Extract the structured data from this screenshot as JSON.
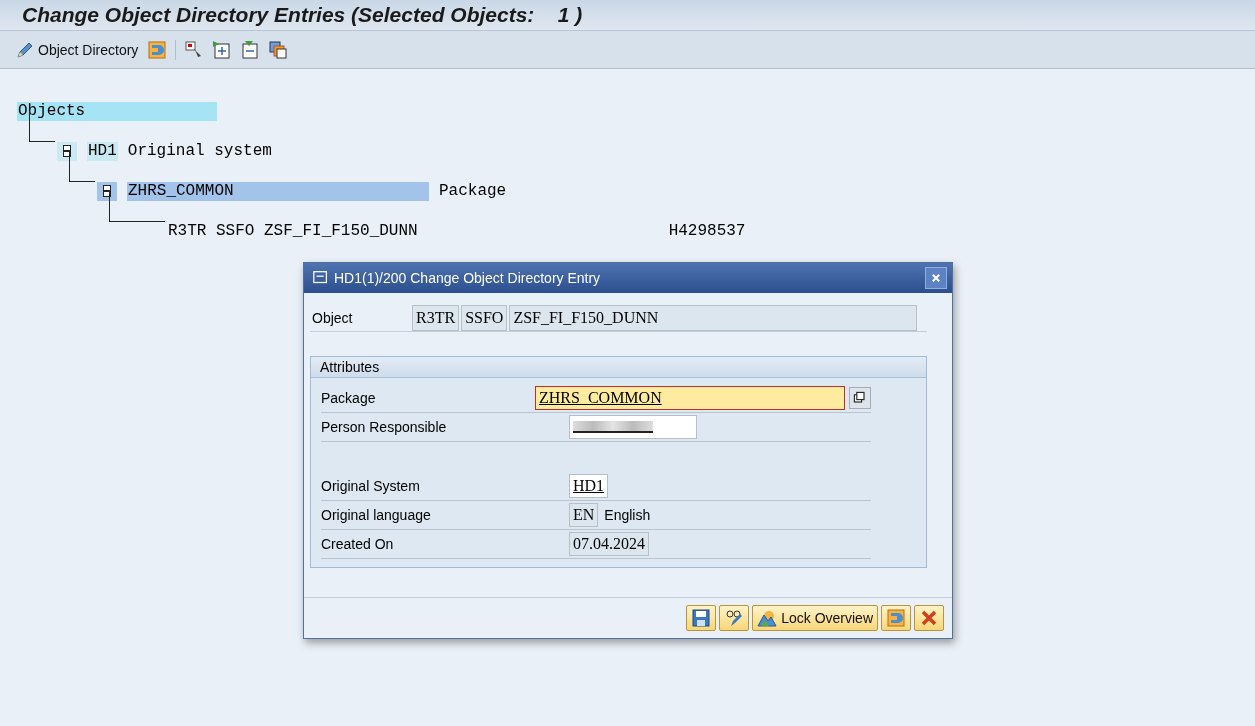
{
  "window": {
    "title": "Change Object Directory Entries (Selected Objects:    1 )"
  },
  "toolbar": {
    "items": [
      {
        "kind": "text",
        "label": "Object Directory"
      },
      {
        "kind": "icon"
      },
      {
        "kind": "sep"
      },
      {
        "kind": "icon"
      },
      {
        "kind": "icon"
      },
      {
        "kind": "icon"
      },
      {
        "kind": "icon"
      }
    ]
  },
  "tree": {
    "nodes": [
      {
        "key": "Objects",
        "selected": false,
        "children": [
          {
            "key": "HD1",
            "description": "Original system",
            "selected": false,
            "expanded": true,
            "children": [
              {
                "key": "ZHRS_COMMON",
                "description": "Package",
                "selected": true,
                "expanded": true,
                "children": [
                  {
                    "key": "R3TR SSFO ZSF_FI_F150_DUNN",
                    "column_2": "H4298537",
                    "selected": false
                  }
                ]
              }
            ]
          }
        ]
      }
    ]
  },
  "dialog": {
    "title": "HD1(1)/200 Change Object Directory Entry",
    "object": {
      "label": "Object",
      "values": [
        "R3TR",
        "SSFO",
        "ZSF_FI_F150_DUNN"
      ]
    },
    "group": {
      "title": "Attributes",
      "fields": [
        {
          "kind": "input",
          "label": "Package",
          "value": "ZHRS_COMMON",
          "focused": true
        },
        {
          "kind": "redacted",
          "label": "Person Responsible"
        },
        {
          "kind": "gap"
        },
        {
          "kind": "input",
          "label": "Original System",
          "value": "HD1",
          "focused": false
        },
        {
          "kind": "display",
          "label": "Original language",
          "value": "EN",
          "text": "English"
        },
        {
          "kind": "display",
          "label": "Created On",
          "value": "07.04.2024"
        }
      ]
    },
    "buttons": [
      {
        "kind": "icon"
      },
      {
        "kind": "icon"
      },
      {
        "kind": "text",
        "label": "Lock Overview"
      },
      {
        "kind": "icon"
      },
      {
        "kind": "icon"
      }
    ]
  }
}
